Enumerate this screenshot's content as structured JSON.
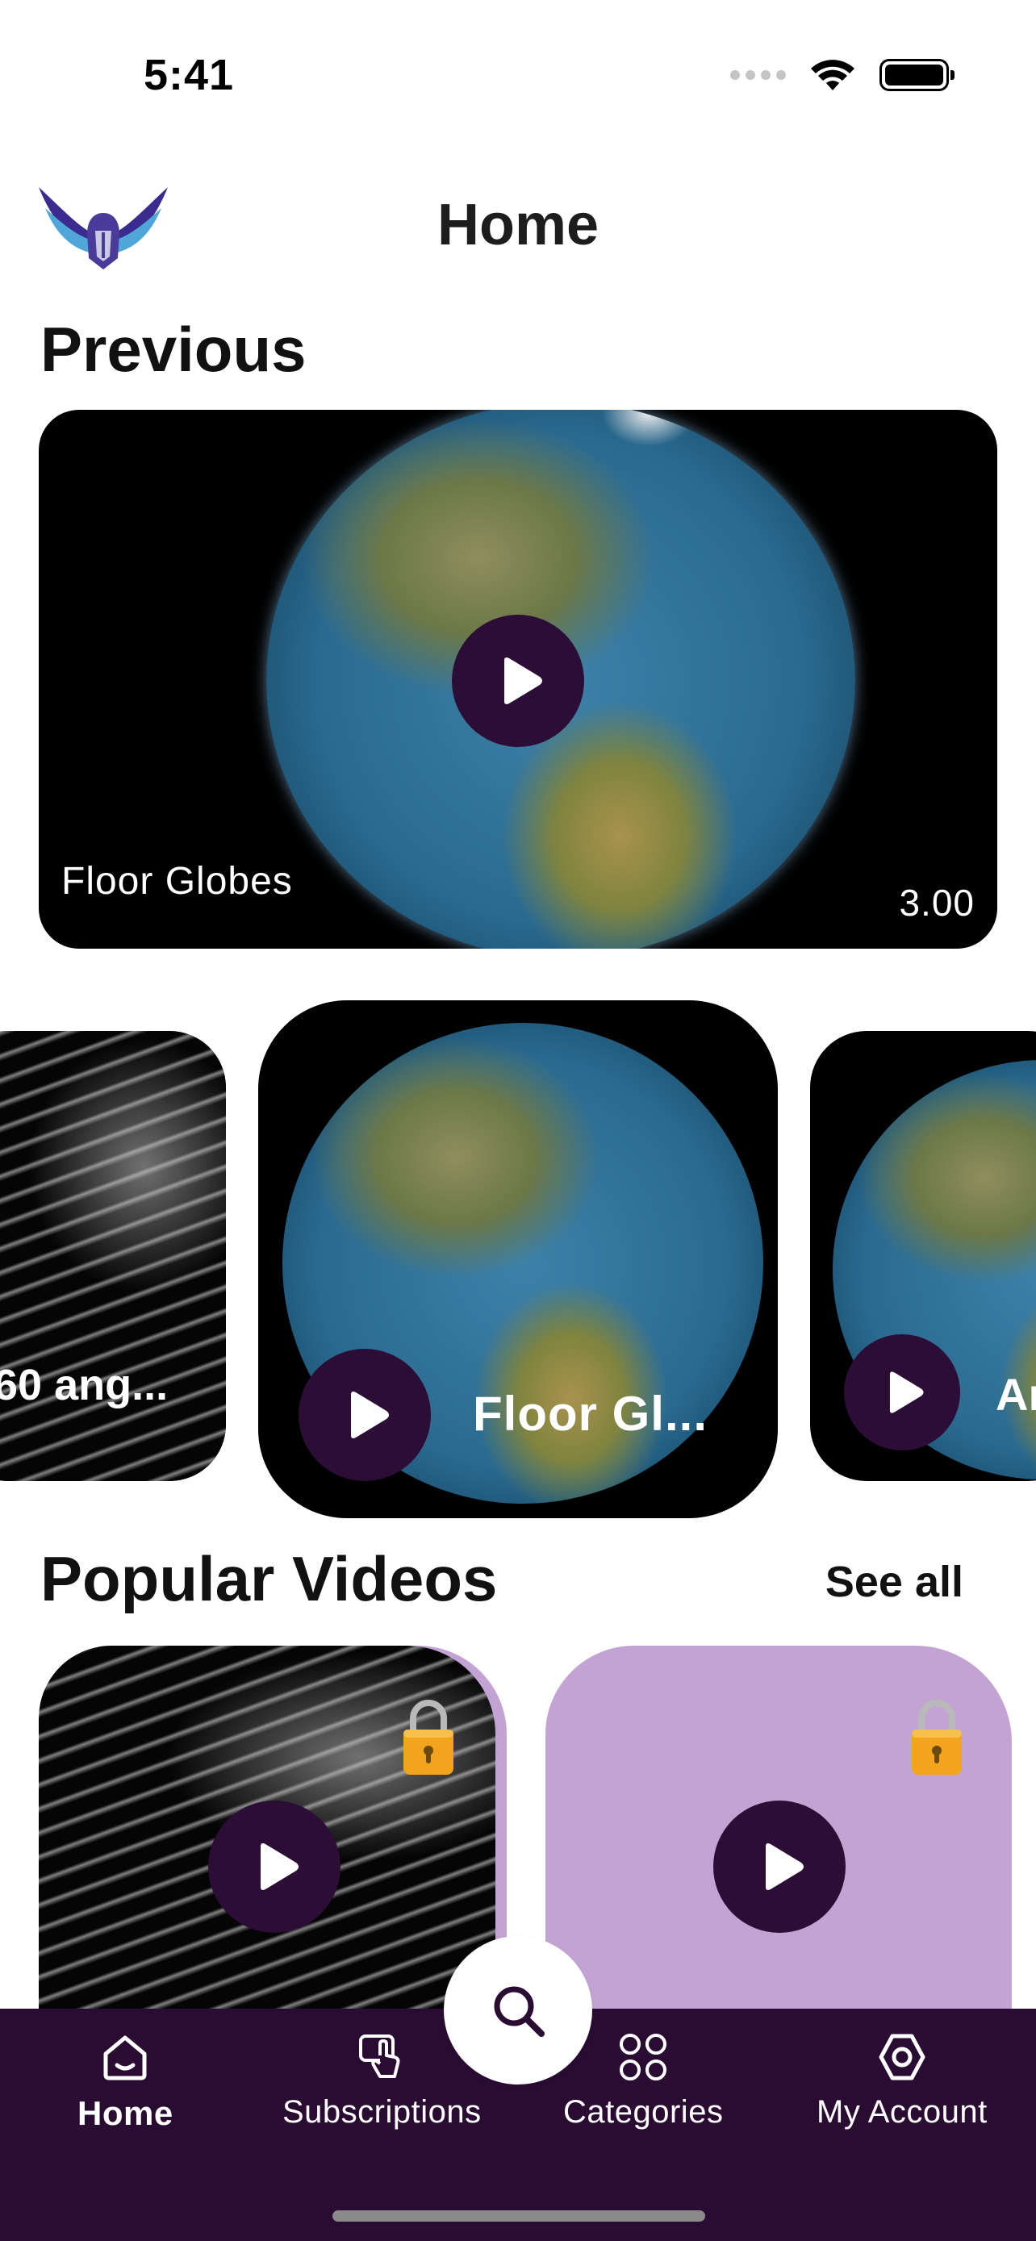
{
  "status_bar": {
    "time": "5:41"
  },
  "header": {
    "title": "Home"
  },
  "previous": {
    "section_title": "Previous",
    "card": {
      "title": "Floor Globes",
      "value": "3.00"
    }
  },
  "carousel": {
    "items": [
      {
        "label": "60 ang..."
      },
      {
        "label": "Floor Gl..."
      },
      {
        "label": "Ar"
      }
    ]
  },
  "popular": {
    "section_title": "Popular Videos",
    "see_all": "See all"
  },
  "bottom_nav": {
    "items": [
      {
        "label": "Home",
        "icon": "home-icon",
        "active": true
      },
      {
        "label": "Subscriptions",
        "icon": "subscriptions-icon"
      },
      {
        "label": "Categories",
        "icon": "categories-icon"
      },
      {
        "label": "My Account",
        "icon": "account-icon"
      }
    ]
  },
  "colors": {
    "brand_dark": "#2a0c33",
    "play_button": "#2b0d35",
    "card_lavender": "#c3a3d3"
  }
}
